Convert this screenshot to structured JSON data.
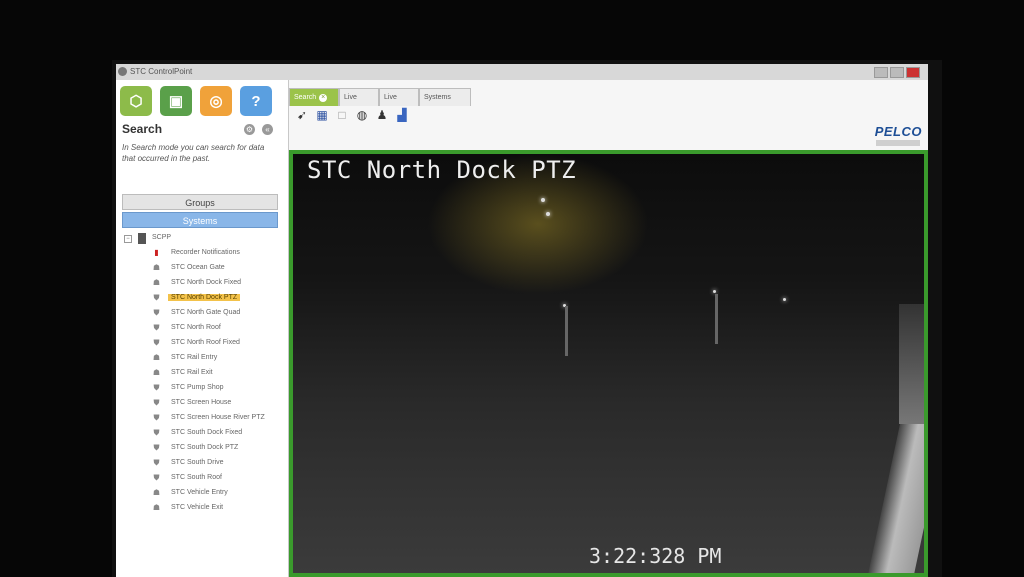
{
  "window": {
    "title": "STC ControlPoint"
  },
  "toolbar": {
    "buttons": [
      {
        "icon": "network-icon",
        "color": "#8dbb4a",
        "glyph": "⬡"
      },
      {
        "icon": "monitor-icon",
        "color": "#5aa04a",
        "glyph": "▣"
      },
      {
        "icon": "binoculars-icon",
        "color": "#f0a23a",
        "glyph": "◎"
      },
      {
        "icon": "help-icon",
        "color": "#5a9fe0",
        "glyph": "?"
      }
    ]
  },
  "search_panel": {
    "title": "Search",
    "description": "In Search mode you can search for data that occurred in the past.",
    "groups_label": "Groups",
    "systems_label": "Systems",
    "tree": {
      "root": "SCPP",
      "items": [
        {
          "label": "Recorder Notifications",
          "icon": "alert-icon",
          "selected": false
        },
        {
          "label": "STC Ocean Gate",
          "icon": "camera-icon",
          "selected": false
        },
        {
          "label": "STC North Dock Fixed",
          "icon": "camera-icon",
          "selected": false
        },
        {
          "label": "STC North Dock PTZ",
          "icon": "ptz-camera-icon",
          "selected": true
        },
        {
          "label": "STC North Gate Quad",
          "icon": "ptz-camera-icon",
          "selected": false
        },
        {
          "label": "STC North Roof",
          "icon": "ptz-camera-icon",
          "selected": false
        },
        {
          "label": "STC North Roof Fixed",
          "icon": "ptz-camera-icon",
          "selected": false
        },
        {
          "label": "STC Rail Entry",
          "icon": "camera-icon",
          "selected": false
        },
        {
          "label": "STC Rail Exit",
          "icon": "camera-icon",
          "selected": false
        },
        {
          "label": "STC Pump Shop",
          "icon": "ptz-camera-icon",
          "selected": false
        },
        {
          "label": "STC Screen House",
          "icon": "ptz-camera-icon",
          "selected": false
        },
        {
          "label": "STC Screen House River PTZ",
          "icon": "ptz-camera-icon",
          "selected": false
        },
        {
          "label": "STC South Dock Fixed",
          "icon": "ptz-camera-icon",
          "selected": false
        },
        {
          "label": "STC South Dock PTZ",
          "icon": "ptz-camera-icon",
          "selected": false
        },
        {
          "label": "STC South Drive",
          "icon": "ptz-camera-icon",
          "selected": false
        },
        {
          "label": "STC South Roof",
          "icon": "ptz-camera-icon",
          "selected": false
        },
        {
          "label": "STC Vehicle Entry",
          "icon": "camera-icon",
          "selected": false
        },
        {
          "label": "STC Vehicle Exit",
          "icon": "camera-icon",
          "selected": false
        }
      ]
    }
  },
  "tabs": [
    {
      "label": "Search",
      "active": true
    },
    {
      "label": "Live",
      "active": false
    },
    {
      "label": "Live",
      "active": false
    },
    {
      "label": "Systems",
      "active": false
    }
  ],
  "brand": {
    "logo_text": "PELCO"
  },
  "video": {
    "camera_title": "STC North Dock PTZ",
    "timestamp": "3:22:328 PM"
  }
}
